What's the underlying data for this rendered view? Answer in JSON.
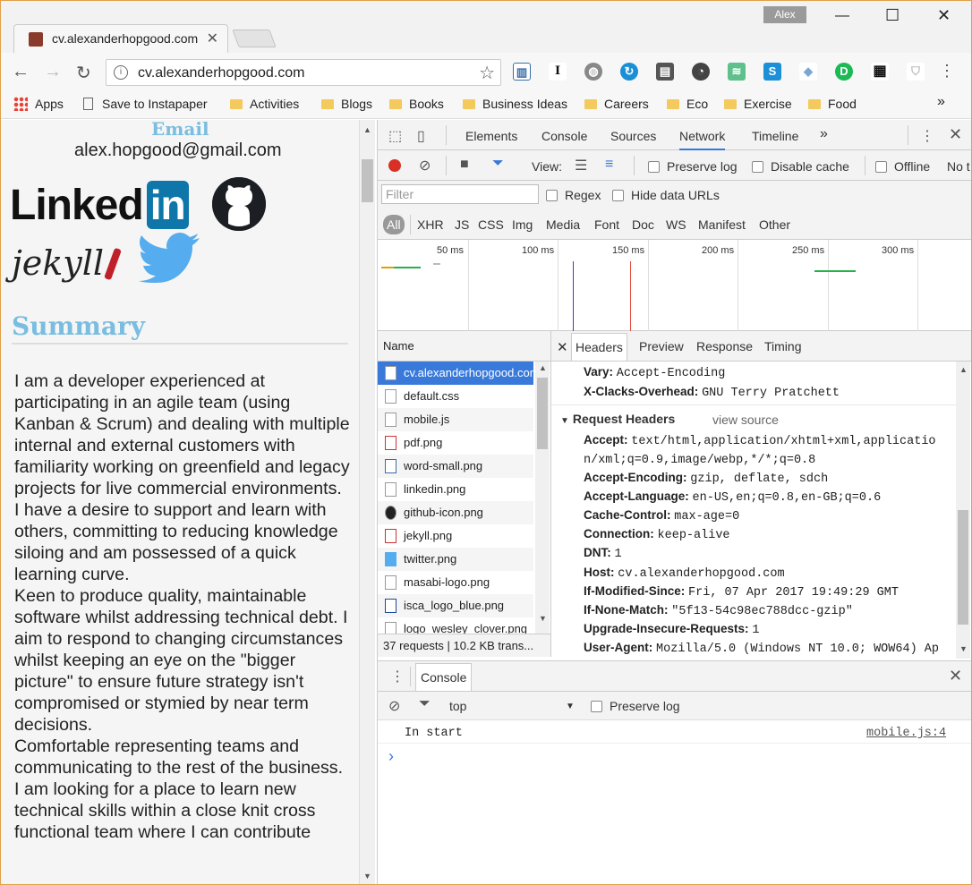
{
  "browser": {
    "tab_title": "cv.alexanderhopgood.com",
    "user_name": "Alex",
    "url": "cv.alexanderhopgood.com",
    "bookmarks": [
      "Apps",
      "Save to Instapaper",
      "Activities",
      "Blogs",
      "Books",
      "Business Ideas",
      "Careers",
      "Eco",
      "Exercise",
      "Food"
    ],
    "overflow": "»"
  },
  "page": {
    "email_heading": "Email",
    "email": "alex.hopgood@gmail.com",
    "linkedin_logo": "Linked",
    "linkedin_in": "in",
    "jekyll_logo": "jekyll",
    "summary_heading": "Summary",
    "summary_paragraphs": [
      "I am a developer experienced at participating in an agile team (using Kanban & Scrum) and dealing with multiple internal and external customers with familiarity working on greenfield and legacy projects for live commercial environments.",
      "I have a desire to support and learn with others, committing to reducing knowledge siloing and am possessed of a quick learning curve.",
      "Keen to produce quality, maintainable software whilst addressing technical debt. I aim to respond to changing circumstances whilst keeping an eye on the \"bigger picture\" to ensure future strategy isn't compromised or stymied by near term decisions.",
      "Comfortable representing teams and communicating to the rest of the business.",
      "I am looking for a place to learn new technical skills within a close knit cross functional team where I can contribute"
    ]
  },
  "devtools": {
    "tabs": [
      "Elements",
      "Console",
      "Sources",
      "Network",
      "Timeline"
    ],
    "active_tab": "Network",
    "more": "»",
    "view_label": "View:",
    "preserve_log": "Preserve log",
    "disable_cache": "Disable cache",
    "offline": "Offline",
    "throttle": "No t",
    "filter_placeholder": "Filter",
    "regex": "Regex",
    "hide_data_urls": "Hide data URLs",
    "types": [
      "All",
      "XHR",
      "JS",
      "CSS",
      "Img",
      "Media",
      "Font",
      "Doc",
      "WS",
      "Manifest",
      "Other"
    ],
    "timeline_labels": [
      "50 ms",
      "100 ms",
      "150 ms",
      "200 ms",
      "250 ms",
      "300 ms"
    ],
    "name_header": "Name",
    "requests": [
      "cv.alexanderhopgood.com",
      "default.css",
      "mobile.js",
      "pdf.png",
      "word-small.png",
      "linkedin.png",
      "github-icon.png",
      "jekyll.png",
      "twitter.png",
      "masabi-logo.png",
      "isca_logo_blue.png",
      "logo_wesley_clover.png"
    ],
    "summary": "37 requests  |  10.2 KB trans...",
    "detail_tabs": [
      "Headers",
      "Preview",
      "Response",
      "Timing"
    ],
    "active_detail_tab": "Headers",
    "response_headers": [
      {
        "k": "Vary:",
        "v": "Accept-Encoding"
      },
      {
        "k": "X-Clacks-Overhead:",
        "v": "GNU Terry Pratchett"
      }
    ],
    "request_headers_title": "Request Headers",
    "view_source": "view source",
    "request_headers": [
      {
        "k": "Accept:",
        "v": "text/html,application/xhtml+xml,applicatio"
      },
      {
        "k": "",
        "v": "n/xml;q=0.9,image/webp,*/*;q=0.8"
      },
      {
        "k": "Accept-Encoding:",
        "v": "gzip, deflate, sdch"
      },
      {
        "k": "Accept-Language:",
        "v": "en-US,en;q=0.8,en-GB;q=0.6"
      },
      {
        "k": "Cache-Control:",
        "v": "max-age=0"
      },
      {
        "k": "Connection:",
        "v": "keep-alive"
      },
      {
        "k": "DNT:",
        "v": "1"
      },
      {
        "k": "Host:",
        "v": "cv.alexanderhopgood.com"
      },
      {
        "k": "If-Modified-Since:",
        "v": "Fri, 07 Apr 2017 19:49:29 GMT"
      },
      {
        "k": "If-None-Match:",
        "v": "\"5f13-54c98ec788dcc-gzip\""
      },
      {
        "k": "Upgrade-Insecure-Requests:",
        "v": "1"
      },
      {
        "k": "User-Agent:",
        "v": "Mozilla/5.0 (Windows NT 10.0; WOW64) Ap"
      }
    ],
    "console_tab": "Console",
    "console_context": "top",
    "console_preserve_log": "Preserve log",
    "log_message": "In start",
    "log_source": "mobile.js:4",
    "prompt": "›"
  }
}
